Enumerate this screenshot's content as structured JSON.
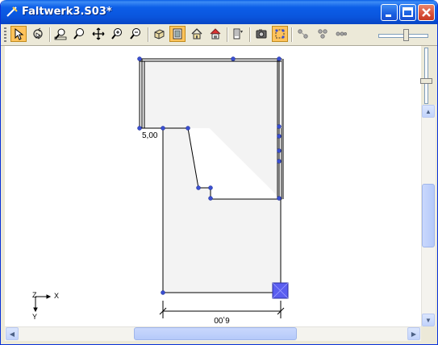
{
  "window": {
    "title": "Faltwerk3.S03*"
  },
  "toolbar": {
    "buttons": [
      {
        "name": "select-arrow-icon",
        "active": true
      },
      {
        "name": "rotate-view-icon",
        "active": false
      },
      {
        "name": "zoom-window-icon",
        "active": false
      },
      {
        "name": "zoom-icon",
        "active": false
      },
      {
        "name": "pan-icon",
        "active": false
      },
      {
        "name": "zoom-in-icon",
        "active": false
      },
      {
        "name": "zoom-out-icon",
        "active": false
      },
      {
        "name": "view-3d-icon",
        "active": false
      },
      {
        "name": "fit-all-icon",
        "active": true
      },
      {
        "name": "home-view-icon",
        "active": false
      },
      {
        "name": "render-view-icon",
        "active": false
      },
      {
        "name": "layer-icon",
        "active": false
      },
      {
        "name": "camera-icon",
        "active": false
      },
      {
        "name": "node-select-icon",
        "active": true
      },
      {
        "name": "node-link-icon",
        "active": false
      },
      {
        "name": "node-group-icon",
        "active": false
      },
      {
        "name": "node-dots-icon",
        "active": false
      }
    ]
  },
  "drawing": {
    "dimension_left": "5,00",
    "dimension_bottom": "6,00",
    "axis_z": "Z",
    "axis_x": "X",
    "axis_y": "Y"
  },
  "colors": {
    "titlebar": "#0a55dd",
    "plate_fill": "#f3f3f3",
    "node": "#3a4fd0",
    "support": "#5a5ef0"
  }
}
